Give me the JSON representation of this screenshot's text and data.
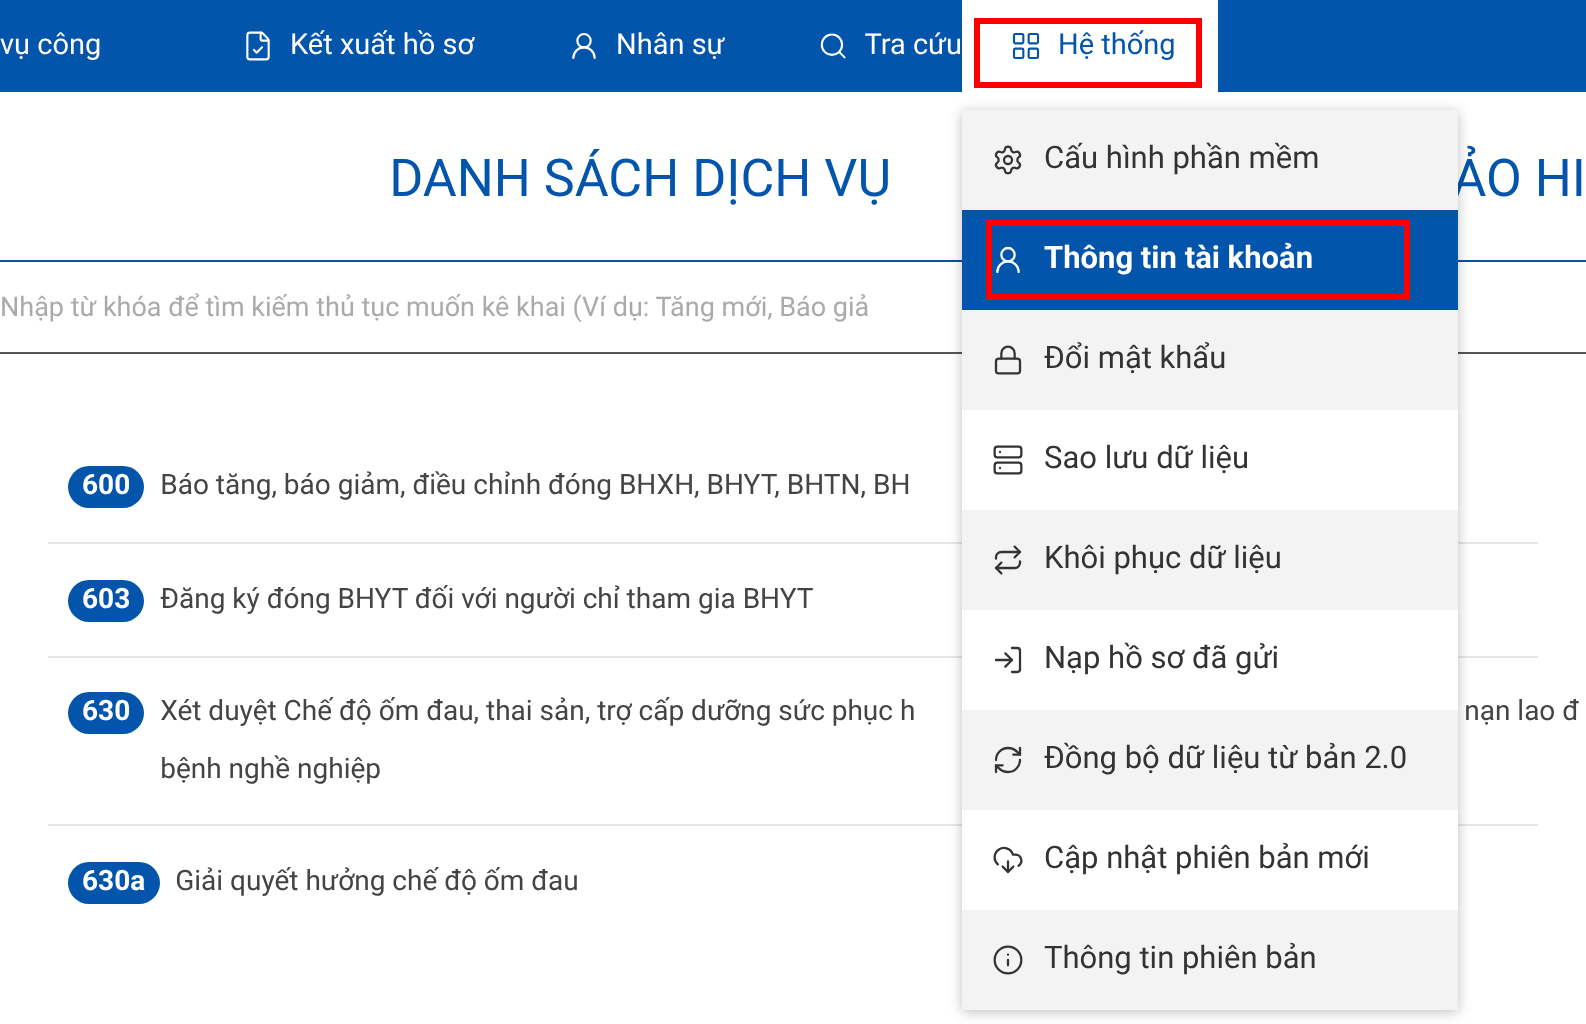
{
  "nav": {
    "items": [
      {
        "label": "vụ công",
        "selected": false,
        "annotated": false
      },
      {
        "label": "Kết xuất hồ sơ",
        "selected": false,
        "annotated": false
      },
      {
        "label": "Nhân sự",
        "selected": false,
        "annotated": false
      },
      {
        "label": "Tra cứu",
        "selected": false,
        "annotated": false
      },
      {
        "label": "Hệ thống",
        "selected": true,
        "annotated": true
      }
    ]
  },
  "title": {
    "left": "DANH SÁCH DỊCH VỤ",
    "right": "ẢO HI"
  },
  "search": {
    "placeholder": "Nhập từ khóa để tìm kiếm thủ tục muốn kê khai (Ví dụ: Tăng mới, Báo giả"
  },
  "services": [
    {
      "code": "600",
      "text": "Báo tăng, báo giảm, điều chỉnh đóng BHXH, BHYT, BHTN, BH"
    },
    {
      "code": "603",
      "text": "Đăng ký đóng BHYT đối với người chỉ tham gia BHYT"
    },
    {
      "code": "630",
      "text": "Xét duyệt Chế độ ốm đau, thai sản, trợ cấp dưỡng sức phục h",
      "text_right": "nạn lao đ",
      "text_line2": "bệnh nghề nghiệp"
    },
    {
      "code": "630a",
      "text": "Giải quyết hưởng chế độ ốm đau"
    }
  ],
  "menu": {
    "items": [
      {
        "label": "Cấu hình phần mềm",
        "selected": false,
        "annotated": false
      },
      {
        "label": "Thông tin tài khoản",
        "selected": true,
        "annotated": true
      },
      {
        "label": "Đổi mật khẩu",
        "selected": false,
        "annotated": false
      },
      {
        "label": "Sao lưu dữ liệu",
        "selected": false,
        "annotated": false
      },
      {
        "label": "Khôi phục dữ liệu",
        "selected": false,
        "annotated": false
      },
      {
        "label": "Nạp hồ sơ đã gửi",
        "selected": false,
        "annotated": false
      },
      {
        "label": "Đồng bộ dữ liệu từ bản 2.0",
        "selected": false,
        "annotated": false
      },
      {
        "label": "Cập nhật phiên bản mới",
        "selected": false,
        "annotated": false
      },
      {
        "label": "Thông tin phiên bản",
        "selected": false,
        "annotated": false
      }
    ]
  }
}
